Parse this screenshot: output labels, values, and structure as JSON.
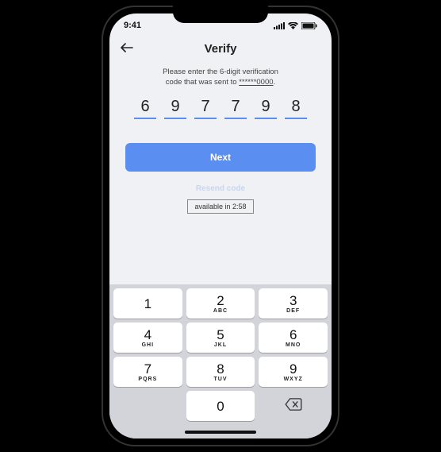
{
  "status_bar": {
    "time": "9:41"
  },
  "header": {
    "title": "Verify"
  },
  "instruction": {
    "line1": "Please enter the 6-digit verification",
    "line2_prefix": "code that was sent to ",
    "phone": "******0000",
    "line2_suffix": "."
  },
  "code": [
    "6",
    "9",
    "7",
    "7",
    "9",
    "8"
  ],
  "next_label": "Next",
  "resend_label": "Resend code",
  "availability_label": "available in 2:58",
  "keypad": [
    [
      {
        "num": "1",
        "letters": ""
      },
      {
        "num": "2",
        "letters": "ABC"
      },
      {
        "num": "3",
        "letters": "DEF"
      }
    ],
    [
      {
        "num": "4",
        "letters": "GHI"
      },
      {
        "num": "5",
        "letters": "JKL"
      },
      {
        "num": "6",
        "letters": "MNO"
      }
    ],
    [
      {
        "num": "7",
        "letters": "PQRS"
      },
      {
        "num": "8",
        "letters": "TUV"
      },
      {
        "num": "9",
        "letters": "WXYZ"
      }
    ],
    [
      {
        "blank": true
      },
      {
        "num": "0",
        "letters": ""
      },
      {
        "backspace": true
      }
    ]
  ]
}
